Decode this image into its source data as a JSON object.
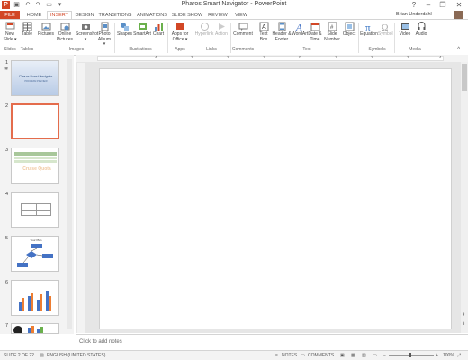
{
  "window": {
    "title": "Pharos Smart Navigator - PowerPoint",
    "controls": [
      "?",
      "–",
      "❐",
      "✕"
    ]
  },
  "quick_access": {
    "icons": [
      "powerpoint-logo",
      "save-icon",
      "undo-icon",
      "redo-icon",
      "slideshow-icon",
      "customize-icon"
    ]
  },
  "tabs": [
    {
      "label": "FILE"
    },
    {
      "label": "HOME"
    },
    {
      "label": "INSERT"
    },
    {
      "label": "DESIGN"
    },
    {
      "label": "TRANSITIONS"
    },
    {
      "label": "ANIMATIONS"
    },
    {
      "label": "SLIDE SHOW"
    },
    {
      "label": "REVIEW"
    },
    {
      "label": "VIEW"
    }
  ],
  "active_tab": "INSERT",
  "user": {
    "name": "Brian Underdahl"
  },
  "ribbon": {
    "buttons": [
      {
        "label": "New Slide ▾"
      },
      {
        "label": "Table"
      },
      {
        "label": "Pictures"
      },
      {
        "label": "Online Pictures"
      },
      {
        "label": "Screenshot ▾"
      },
      {
        "label": "Photo Album ▾"
      },
      {
        "label": "Shapes"
      },
      {
        "label": "SmartArt"
      },
      {
        "label": "Chart"
      },
      {
        "label": "Apps for Office ▾"
      },
      {
        "label": "Hyperlink"
      },
      {
        "label": "Action"
      },
      {
        "label": "Comment"
      },
      {
        "label": "Text Box"
      },
      {
        "label": "Header & Footer"
      },
      {
        "label": "WordArt"
      },
      {
        "label": "Date & Time"
      },
      {
        "label": "Slide Number"
      },
      {
        "label": "Object"
      },
      {
        "label": "Equation"
      },
      {
        "label": "Symbol"
      },
      {
        "label": "Video"
      },
      {
        "label": "Audio"
      }
    ],
    "groups": [
      "Slides",
      "Tables",
      "Images",
      "Illustrations",
      "Apps",
      "Links",
      "Comments",
      "Text",
      "Symbols",
      "Media"
    ]
  },
  "ruler": {
    "ticks": [
      "4",
      "3",
      "2",
      "1",
      "0",
      "1",
      "2",
      "3",
      "4"
    ]
  },
  "slides": [
    {
      "number": "1",
      "title": "Pharos Smart Navigator",
      "subtitle": "PROGRAM PREVIEW"
    },
    {
      "number": "2"
    },
    {
      "number": "3",
      "title": "Cruise Quota"
    },
    {
      "number": "4"
    },
    {
      "number": "5",
      "title": "Your Plan"
    },
    {
      "number": "6"
    },
    {
      "number": "7"
    }
  ],
  "notes": {
    "placeholder": "Click to add notes"
  },
  "status": {
    "slide_info": "SLIDE 2 OF 22",
    "language": "ENGLISH (UNITED STATES)",
    "notes_label": "NOTES",
    "comments_label": "COMMENTS",
    "zoom": "100%"
  },
  "colors": {
    "accent": "#d24726",
    "selection": "#e46c4c"
  }
}
